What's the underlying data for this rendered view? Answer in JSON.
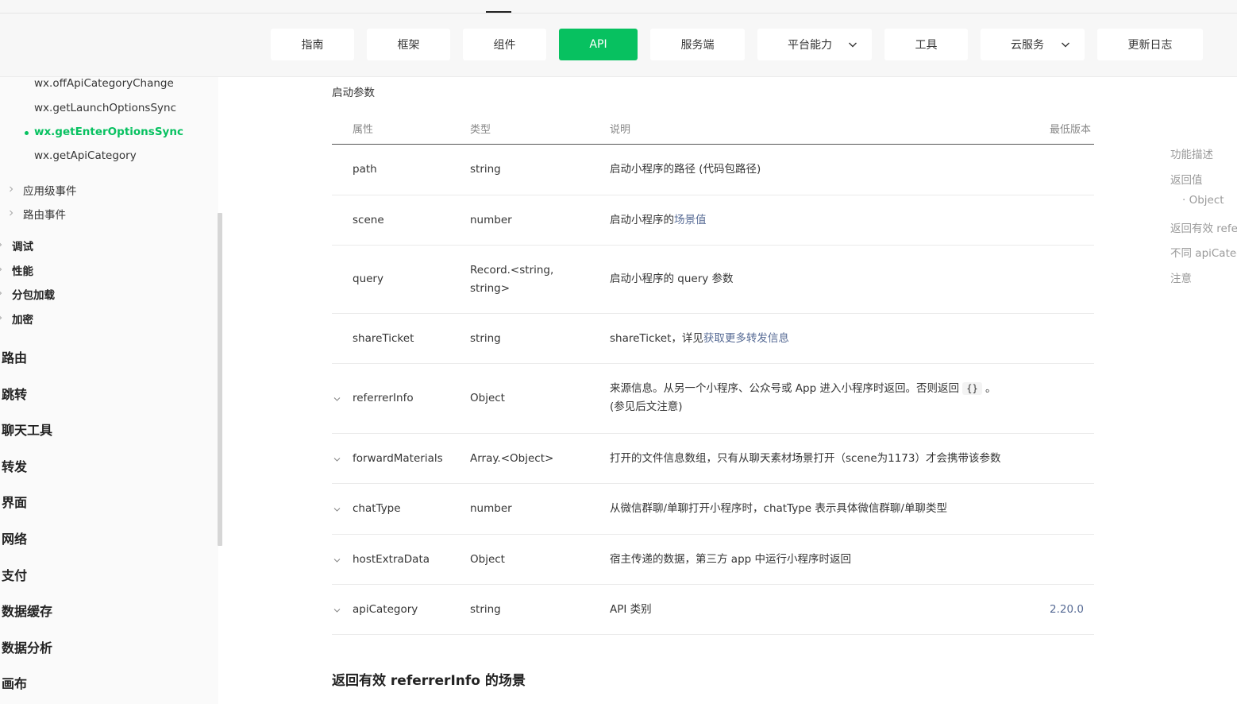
{
  "nav": {
    "items": [
      {
        "label": "指南"
      },
      {
        "label": "框架"
      },
      {
        "label": "组件"
      },
      {
        "label": "API"
      },
      {
        "label": "服务端"
      },
      {
        "label": "平台能力"
      },
      {
        "label": "工具"
      },
      {
        "label": "云服务"
      },
      {
        "label": "更新日志"
      }
    ],
    "active": "API",
    "accent_color": "#07c160"
  },
  "sidebar": {
    "sub_items": [
      {
        "label": "wx.offApiCategoryChange"
      },
      {
        "label": "wx.getLaunchOptionsSync"
      },
      {
        "label": "wx.getEnterOptionsSync"
      },
      {
        "label": "wx.getApiCategory"
      }
    ],
    "groups": [
      {
        "label": "应用级事件"
      },
      {
        "label": "路由事件"
      }
    ],
    "sections": [
      {
        "label": "调试"
      },
      {
        "label": "性能"
      },
      {
        "label": "分包加载"
      },
      {
        "label": "加密"
      }
    ],
    "categories": [
      {
        "label": "路由"
      },
      {
        "label": "跳转"
      },
      {
        "label": "聊天工具"
      },
      {
        "label": "转发"
      },
      {
        "label": "界面"
      },
      {
        "label": "网络"
      },
      {
        "label": "支付"
      },
      {
        "label": "数据缓存"
      },
      {
        "label": "数据分析"
      },
      {
        "label": "画布"
      }
    ]
  },
  "content": {
    "section_label": "启动参数",
    "headers": {
      "attr": "属性",
      "type": "类型",
      "desc": "说明",
      "version": "最低版本"
    },
    "rows": [
      {
        "attr": "path",
        "type": "string",
        "desc": "启动小程序的路径 (代码包路径)"
      },
      {
        "attr": "scene",
        "type": "number",
        "desc_prefix": "启动小程序的",
        "desc_link": "场景值"
      },
      {
        "attr": "query",
        "type_line1": "Record.<string,",
        "type_line2": "string>",
        "desc": "启动小程序的 query 参数"
      },
      {
        "attr": "shareTicket",
        "type": "string",
        "desc_prefix": "shareTicket，详见",
        "desc_link": "获取更多转发信息"
      },
      {
        "attr": "referrerInfo",
        "type": "Object",
        "desc_line1_prefix": "来源信息。从另一个小程序、公众号或 App 进入小程序时返回。否则返回",
        "desc_code": "{}",
        "desc_line1_suffix": "。",
        "desc_line2": "(参见后文注意)"
      },
      {
        "attr": "forwardMaterials",
        "type": "Array.<Object>",
        "desc": "打开的文件信息数组，只有从聊天素材场景打开（scene为1173）才会携带该参数"
      },
      {
        "attr": "chatType",
        "type": "number",
        "desc": "从微信群聊/单聊打开小程序时，chatType 表示具体微信群聊/单聊类型"
      },
      {
        "attr": "hostExtraData",
        "type": "Object",
        "desc": "宿主传递的数据，第三方 app 中运行小程序时返回"
      },
      {
        "attr": "apiCategory",
        "type": "string",
        "desc": "API 类别",
        "version": "2.20.0"
      }
    ],
    "next_section_title": "返回有效 referrerInfo 的场景"
  },
  "toc": {
    "items": [
      {
        "label": "功能描述"
      },
      {
        "label": "返回值"
      },
      {
        "label": "· Object"
      },
      {
        "label": "返回有效 referrerInfo 的场景"
      },
      {
        "label": "不同 apiCategory 场景下的 API 限制"
      },
      {
        "label": "注意"
      }
    ]
  }
}
